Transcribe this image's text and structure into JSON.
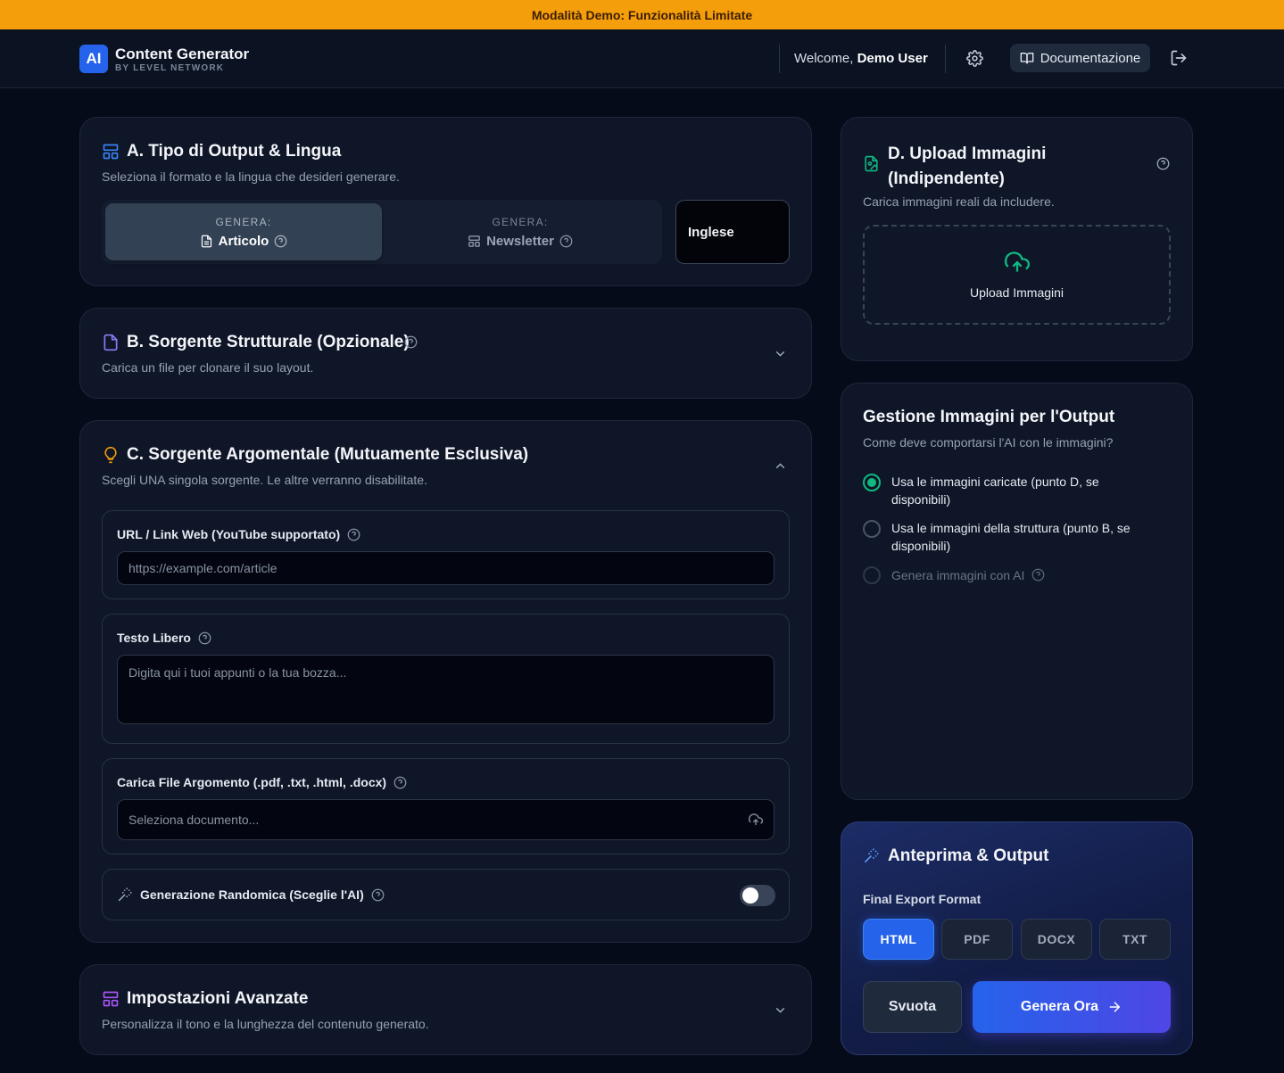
{
  "banner": {
    "text": "Modalità Demo: Funzionalità Limitate"
  },
  "header": {
    "logo": "AI",
    "title": "Content Generator",
    "subtitle": "BY LEVEL NETWORK",
    "welcome_prefix": "Welcome, ",
    "user_name": "Demo User",
    "docs_label": "Documentazione"
  },
  "section_a": {
    "title": "A. Tipo di Output & Lingua",
    "desc": "Seleziona il formato e la lingua che desideri generare.",
    "options": [
      {
        "caption": "GENERA:",
        "label": "Articolo",
        "active": true
      },
      {
        "caption": "GENERA:",
        "label": "Newsletter",
        "active": false
      }
    ],
    "language": "Inglese"
  },
  "section_b": {
    "title": "B. Sorgente Strutturale (Opzionale)",
    "desc": "Carica un file per clonare il suo layout."
  },
  "section_c": {
    "title": "C. Sorgente Argomentale (Mutuamente Esclusiva)",
    "desc": "Scegli UNA singola sorgente. Le altre verranno disabilitate.",
    "url_label": "URL / Link Web (YouTube supportato)",
    "url_placeholder": "https://example.com/article",
    "text_label": "Testo Libero",
    "text_placeholder": "Digita qui i tuoi appunti o la tua bozza...",
    "file_label": "Carica File Argomento (.pdf, .txt, .html, .docx)",
    "file_placeholder": "Seleziona documento...",
    "random_label": "Generazione Randomica (Sceglie l'AI)",
    "random_enabled": false
  },
  "advanced": {
    "title": "Impostazioni Avanzate",
    "desc": "Personalizza il tono e la lunghezza del contenuto generato."
  },
  "section_d": {
    "title_line1": "D. Upload Immagini",
    "title_line2": "(Indipendente)",
    "desc": "Carica immagini reali da includere.",
    "upload_label": "Upload Immagini"
  },
  "images": {
    "title": "Gestione Immagini per l'Output",
    "desc": "Come deve comportarsi l'AI con le immagini?",
    "options": [
      {
        "line1": "Usa le immagini caricate (punto D, se",
        "line2": "disponibili)",
        "selected": true
      },
      {
        "line1": "Usa le immagini della struttura (punto B, se",
        "line2": "disponibili)",
        "selected": false
      },
      {
        "line1": "Genera immagini con AI",
        "selected": false,
        "disabled": true
      }
    ]
  },
  "output": {
    "title": "Anteprima & Output",
    "format_label": "Final Export Format",
    "formats": [
      "HTML",
      "PDF",
      "DOCX",
      "TXT"
    ],
    "active_format": "HTML",
    "clear_label": "Svuota",
    "generate_label": "Genera Ora"
  },
  "colors": {
    "banner": "#f59e0b",
    "accent": "#2563eb",
    "success": "#10b981",
    "background": "#060b1a"
  }
}
